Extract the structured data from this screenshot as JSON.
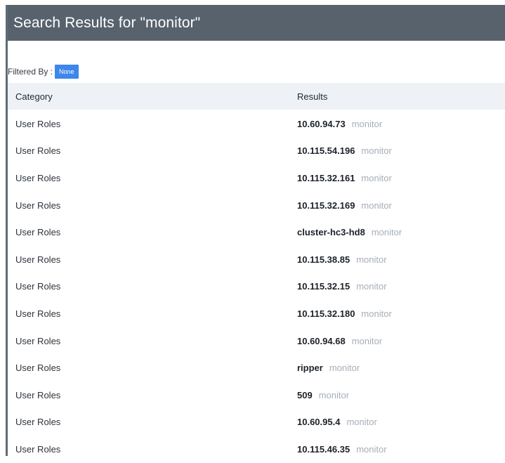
{
  "header": {
    "title": "Search Results for \"monitor\""
  },
  "filter": {
    "label": "Filtered By :",
    "value": "None"
  },
  "table": {
    "columns": {
      "category": "Category",
      "results": "Results"
    },
    "rows": [
      {
        "category": "User Roles",
        "name": "10.60.94.73",
        "role": "monitor"
      },
      {
        "category": "User Roles",
        "name": "10.115.54.196",
        "role": "monitor"
      },
      {
        "category": "User Roles",
        "name": "10.115.32.161",
        "role": "monitor"
      },
      {
        "category": "User Roles",
        "name": "10.115.32.169",
        "role": "monitor"
      },
      {
        "category": "User Roles",
        "name": "cluster-hc3-hd8",
        "role": "monitor"
      },
      {
        "category": "User Roles",
        "name": "10.115.38.85",
        "role": "monitor"
      },
      {
        "category": "User Roles",
        "name": "10.115.32.15",
        "role": "monitor"
      },
      {
        "category": "User Roles",
        "name": "10.115.32.180",
        "role": "monitor"
      },
      {
        "category": "User Roles",
        "name": "10.60.94.68",
        "role": "monitor"
      },
      {
        "category": "User Roles",
        "name": "ripper",
        "role": "monitor"
      },
      {
        "category": "User Roles",
        "name": "509",
        "role": "monitor"
      },
      {
        "category": "User Roles",
        "name": "10.60.95.4",
        "role": "monitor"
      },
      {
        "category": "User Roles",
        "name": "10.115.46.35",
        "role": "monitor"
      }
    ]
  }
}
